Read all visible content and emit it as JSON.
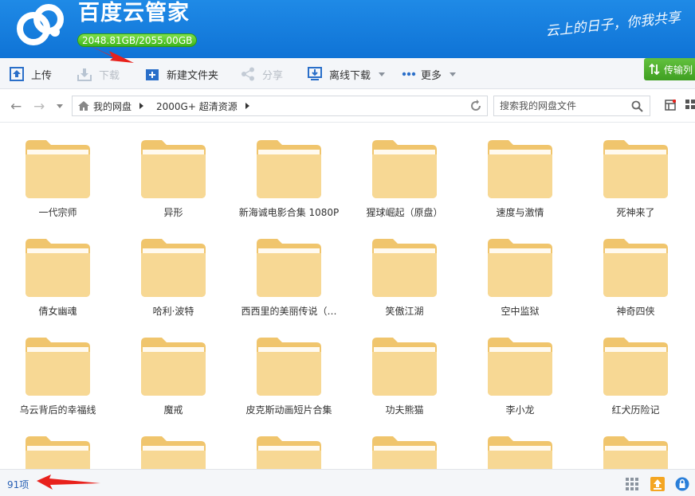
{
  "header": {
    "app_title": "百度云管家",
    "quota": "2048.81GB/2055.00GB",
    "slogan": "云上的日子，你我共享"
  },
  "toolbar": {
    "upload": "上传",
    "download": "下载",
    "new_folder": "新建文件夹",
    "share": "分享",
    "offline_download": "离线下载",
    "more": "更多",
    "transfer_list": "传输列"
  },
  "nav": {
    "breadcrumb": [
      "我的网盘",
      "2000G+ 超清资源"
    ],
    "search_placeholder": "搜索我的网盘文件"
  },
  "folders": [
    "一代宗师",
    "异形",
    "新海诚电影合集 1080P",
    "猩球崛起（原盘）",
    "速度与激情",
    "死神来了",
    "倩女幽魂",
    "哈利·波特",
    "西西里的美丽传说（…",
    "笑傲江湖",
    "空中监狱",
    "神奇四侠",
    "乌云背后的幸福线",
    "魔戒",
    "皮克斯动画短片合集",
    "功夫熊猫",
    "李小龙",
    "红犬历险记",
    "",
    "",
    "",
    "",
    "",
    ""
  ],
  "status": {
    "count": "91项"
  },
  "colors": {
    "header": "#1482e0",
    "quota_green": "#4cc023",
    "folder": "#f5d48f",
    "annotation": "#e8211c"
  }
}
